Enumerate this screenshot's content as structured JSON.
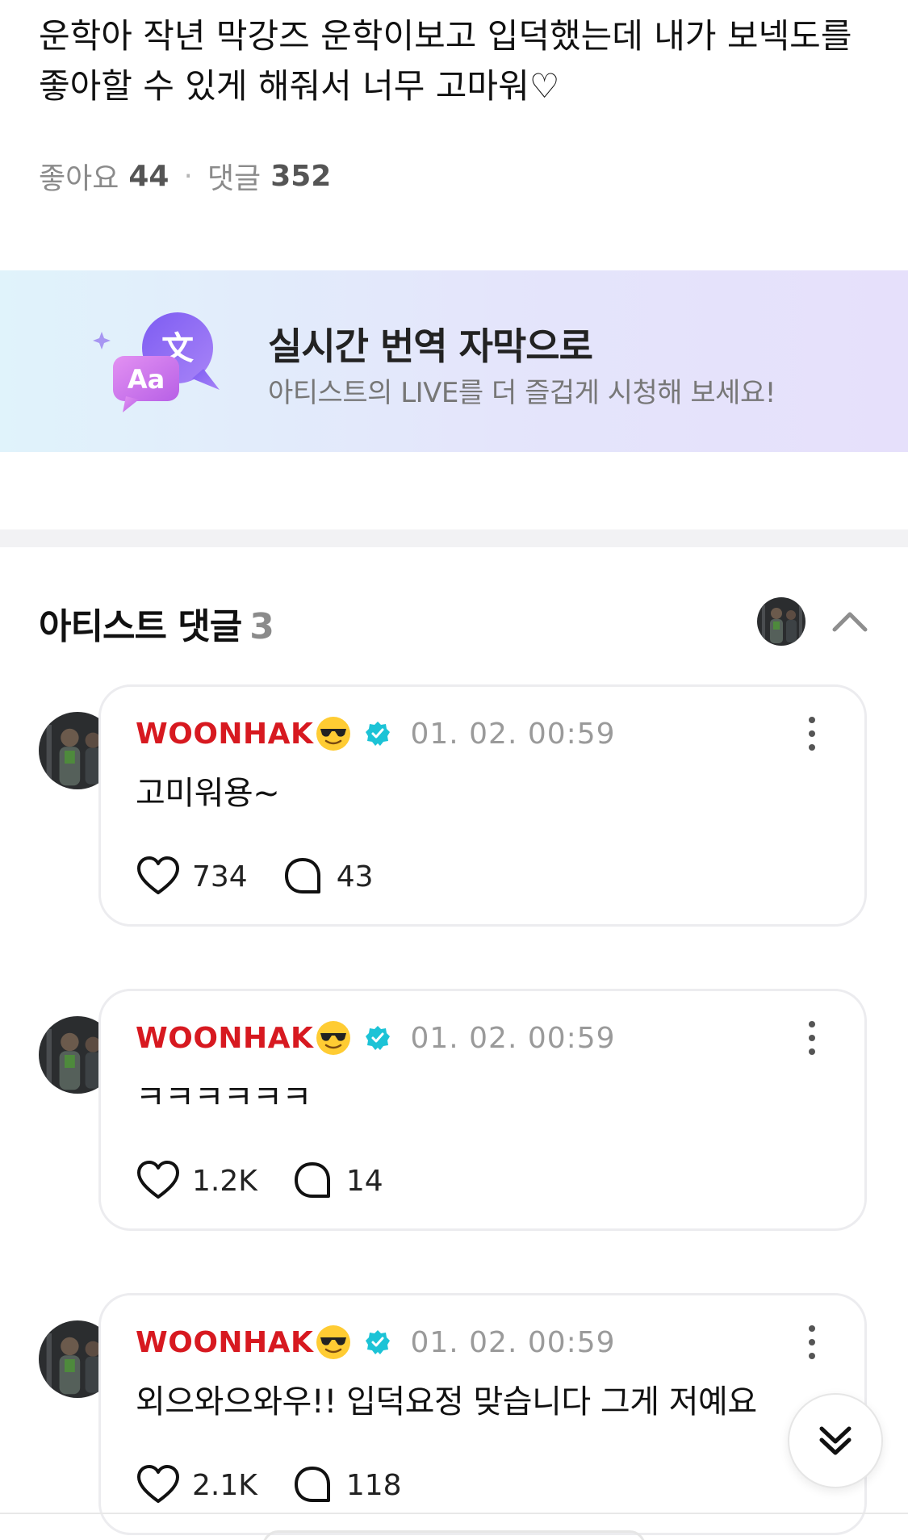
{
  "post": {
    "text": "운학아 작년 막강즈 운학이보고 입덕했는데 내가 보넥도를 좋아할 수 있게 해줘서 너무 고마워♡",
    "likes_label": "좋아요",
    "likes_count": "44",
    "separator": "·",
    "comments_label": "댓글",
    "comments_count": "352"
  },
  "banner": {
    "title": "실시간 번역 자막으로",
    "subtitle": "아티스트의 LIVE를 더 즐겁게 시청해 보세요!",
    "icon_translate_glyph": "文",
    "icon_aa_glyph": "Aa"
  },
  "artist_comments": {
    "title": "아티스트 댓글",
    "count": "3",
    "items": [
      {
        "author": "WOONHAK",
        "time": "01. 02. 00:59",
        "text": "고미워용~",
        "likes": "734",
        "replies": "43"
      },
      {
        "author": "WOONHAK",
        "time": "01. 02. 00:59",
        "text": "ㅋㅋㅋㅋㅋㅋ",
        "likes": "1.2K",
        "replies": "14"
      },
      {
        "author": "WOONHAK",
        "time": "01. 02. 00:59",
        "text": "외으와으와우!! 입덕요정 맞습니다 그게 저예요",
        "likes": "2.1K",
        "replies": "118"
      }
    ]
  },
  "colors": {
    "author_red": "#d71920",
    "verified_teal": "#1cc3d6",
    "banner_bubble_purple": "#8a66f0",
    "banner_bubble_pink": "#c86ce6"
  },
  "icons": [
    "chevron-up-icon",
    "sunglasses-emoji",
    "verified-badge-icon",
    "more-vertical-icon",
    "heart-icon",
    "comment-bubble-icon",
    "double-chevron-down-icon"
  ]
}
